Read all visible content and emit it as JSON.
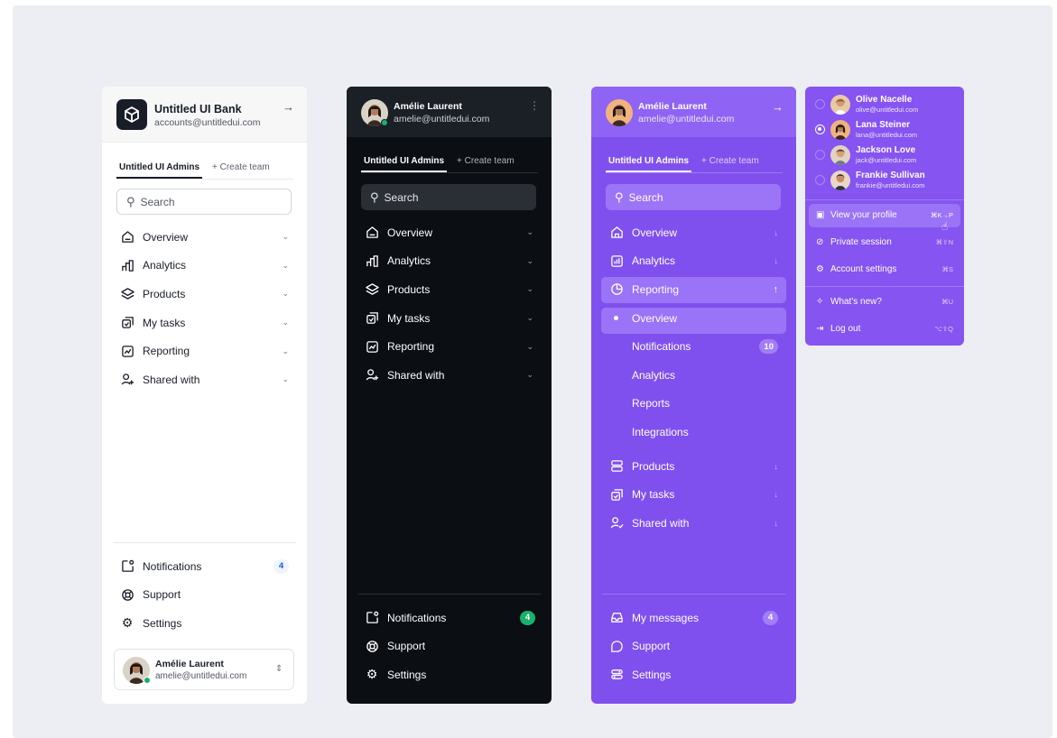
{
  "light": {
    "brand_name": "Untitled UI Bank",
    "brand_email": "accounts@untitledui.com",
    "tab_active": "Untitled UI Admins",
    "tab_create": "+ Create team",
    "search_placeholder": "Search",
    "nav": [
      "Overview",
      "Analytics",
      "Products",
      "My tasks",
      "Reporting",
      "Shared with"
    ],
    "footer": {
      "notifications": "Notifications",
      "notifications_count": "4",
      "support": "Support",
      "settings": "Settings"
    },
    "user_name": "Amélie Laurent",
    "user_email": "amelie@untitledui.com"
  },
  "dark": {
    "user_name": "Amélie Laurent",
    "user_email": "amelie@untitledui.com",
    "tab_active": "Untitled UI Admins",
    "tab_create": "+ Create team",
    "search_placeholder": "Search",
    "nav": [
      "Overview",
      "Analytics",
      "Products",
      "My tasks",
      "Reporting",
      "Shared with"
    ],
    "footer": {
      "notifications": "Notifications",
      "notifications_count": "4",
      "support": "Support",
      "settings": "Settings"
    }
  },
  "purple": {
    "user_name": "Amélie Laurent",
    "user_email": "amelie@untitledui.com",
    "tab_active": "Untitled UI Admins",
    "tab_create": "+ Create team",
    "search_placeholder": "Search",
    "nav_top": [
      "Overview",
      "Analytics"
    ],
    "reporting": "Reporting",
    "sub": [
      "Overview",
      "Notifications",
      "Analytics",
      "Reports",
      "Integrations"
    ],
    "sub_notifications_count": "10",
    "nav_bottom": [
      "Products",
      "My tasks",
      "Shared with"
    ],
    "footer": {
      "messages": "My messages",
      "messages_count": "4",
      "support": "Support",
      "settings": "Settings"
    }
  },
  "dropdown": {
    "accounts": [
      {
        "name": "Olive Nacelle",
        "email": "olive@untitledui.com"
      },
      {
        "name": "Lana Steiner",
        "email": "lana@untitledui.com"
      },
      {
        "name": "Jackson Love",
        "email": "jack@untitledui.com"
      },
      {
        "name": "Frankie Sullivan",
        "email": "frankie@untitledui.com"
      }
    ],
    "selected_account": "Lana Steiner",
    "menu": [
      {
        "label": "View your profile",
        "shortcut": "⌘K→P"
      },
      {
        "label": "Private session",
        "shortcut": "⌘⇧N"
      },
      {
        "label": "Account settings",
        "shortcut": "⌘S"
      },
      {
        "label": "What's new?",
        "shortcut": "⌘U"
      },
      {
        "label": "Log out",
        "shortcut": "⌥⇧Q"
      }
    ]
  },
  "colors": {
    "canvas": "#eceef3",
    "dark_panel": "#0b0e13",
    "purple_panel": "#8050ee",
    "online": "#17b26a",
    "badge_blue_bg": "#eff4ff",
    "badge_blue_text": "#175cd3"
  }
}
